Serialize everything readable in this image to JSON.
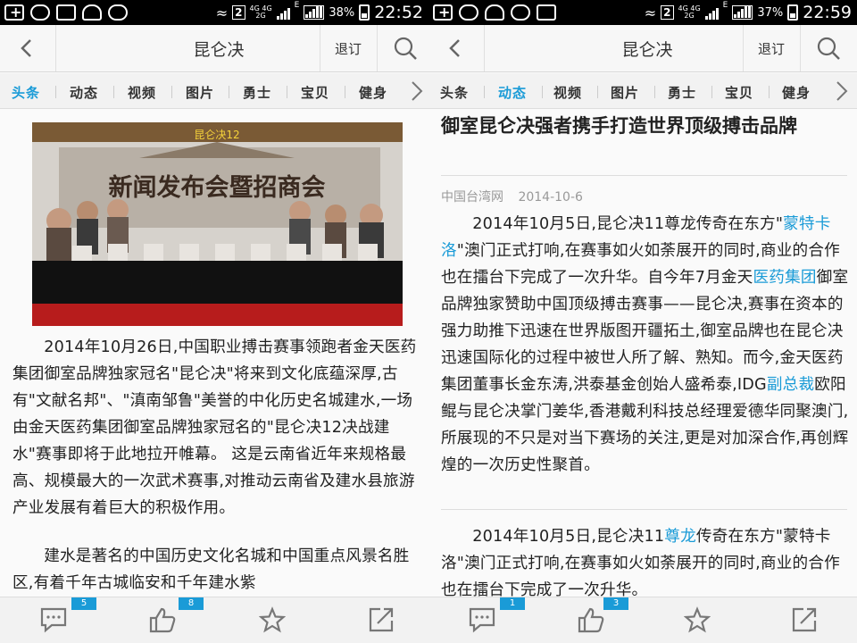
{
  "left": {
    "status": {
      "sim": "2",
      "network_top": "4G 4G",
      "network_bottom": "2G",
      "network_e": "E",
      "battery": "38%",
      "time": "22:52"
    },
    "title": "昆仑决",
    "unsubscribe": "退订",
    "tabs": [
      "头条",
      "动态",
      "视频",
      "图片",
      "勇士",
      "宝贝",
      "健身"
    ],
    "active_tab": 0,
    "photo": {
      "banner_line1": "新闻发布会暨招商会",
      "banner_top": "昆仑决12"
    },
    "paragraphs": [
      "2014年10月26日,中国职业搏击赛事领跑者金天医药集团御室品牌独家冠名\"昆仑决\"将来到文化底蕴深厚,古有\"文献名邦\"、\"滇南邹鲁\"美誉的中化历史名城建水,一场由金天医药集团御室品牌独家冠名的\"昆仑决12决战建水\"赛事即将于此地拉开帷幕。 这是云南省近年来规格最高、规模最大的一次武术赛事,对推动云南省及建水县旅游产业发展有着巨大的积极作用。",
      "建水是著名的中国历史文化名城和中国重点风景名胜区,有着千年古城临安和千年建水紫"
    ],
    "bottom": {
      "comments": "5",
      "likes": "8"
    }
  },
  "right": {
    "status": {
      "sim": "2",
      "network_top": "4G 4G",
      "network_bottom": "2G",
      "network_e": "E",
      "battery": "37%",
      "time": "22:59"
    },
    "title": "昆仑决",
    "unsubscribe": "退订",
    "tabs": [
      "头条",
      "动态",
      "视频",
      "图片",
      "勇士",
      "宝贝",
      "健身"
    ],
    "active_tab": 1,
    "headline": "御室昆仑决强者携手打造世界顶级搏击品牌",
    "source": "中国台湾网",
    "date": "2014-10-6",
    "p1": {
      "a": "2014年10月5日,昆仑决11尊龙传奇在东方\"",
      "link1": "蒙特卡洛",
      "b": "\"澳门正式打响,在赛事如火如荼展开的同时,商业的合作也在擂台下完成了一次升华。自今年7月金天",
      "link2": "医药集团",
      "c": "御室品牌独家赞助中国顶级搏击赛事——昆仑决,赛事在资本的强力助推下迅速在世界版图开疆拓土,御室品牌也在昆仑决迅速国际化的过程中被世人所了解、熟知。而今,金天医药集团董事长金东涛,洪泰基金创始人盛希泰,IDG",
      "link3": "副总裁",
      "d": "欧阳鲲与昆仑决掌门姜华,香港戴利科技总经理爱德华同聚澳门,所展现的不只是对当下赛场的关注,更是对加深合作,再创辉煌的一次历史性聚首。"
    },
    "p2": {
      "a": "2014年10月5日,昆仑决11",
      "link1": "尊龙",
      "b": "传奇在东方\"蒙特卡洛\"澳门正式打响,在赛事如火如荼展开的同时,商业的合作也在擂台下完成了一次升华。"
    },
    "bottom": {
      "comments": "1",
      "likes": "3"
    }
  }
}
